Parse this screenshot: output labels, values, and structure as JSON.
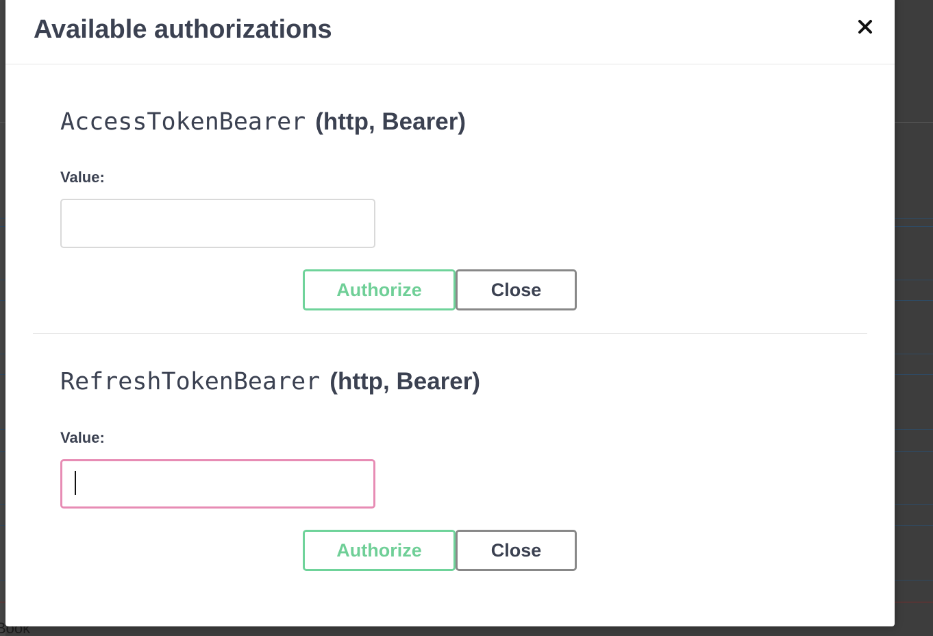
{
  "modal": {
    "title": "Available authorizations",
    "close_icon": "close-icon"
  },
  "schemes": [
    {
      "name": "AccessTokenBearer",
      "type": "(http, Bearer)",
      "value_label": "Value:",
      "value": "",
      "authorize_label": "Authorize",
      "close_label": "Close"
    },
    {
      "name": "RefreshTokenBearer",
      "type": "(http, Bearer)",
      "value_label": "Value:",
      "value": "",
      "authorize_label": "Authorize",
      "close_label": "Close",
      "focused": true
    }
  ],
  "background": {
    "partial_text": "Book"
  },
  "colors": {
    "authorize": "#6fcf97",
    "focus_border": "#e78cb4",
    "text": "#3b4151",
    "close_border": "#888888"
  }
}
